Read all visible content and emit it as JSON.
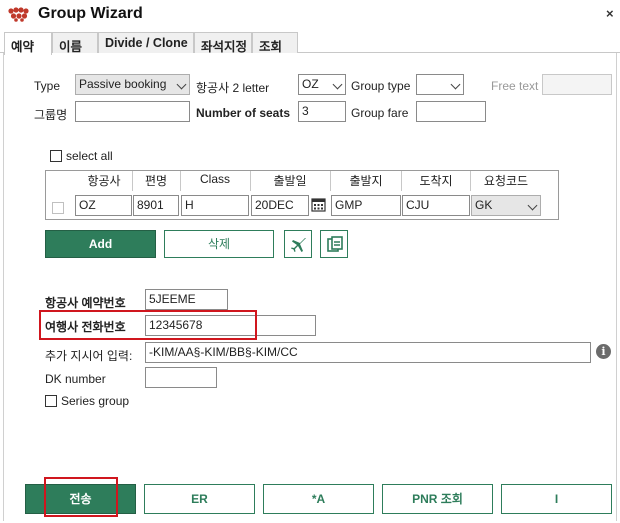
{
  "window": {
    "title": "Group Wizard",
    "close_glyph": "×"
  },
  "tabs": [
    {
      "label": "예약"
    },
    {
      "label": "이름"
    },
    {
      "label": "Divide / Clone"
    },
    {
      "label": "좌석지정"
    },
    {
      "label": "조회"
    }
  ],
  "form": {
    "type_label": "Type",
    "type_value": "Passive booking",
    "airline_label": "항공사 2 letter",
    "airline_value": "OZ",
    "group_type_label": "Group type",
    "group_type_value": "",
    "free_text_label": "Free text",
    "free_text_value": "",
    "group_name_label": "그룹명",
    "group_name_value": "",
    "seats_label": "Number of seats",
    "seats_value": "3",
    "group_fare_label": "Group fare",
    "group_fare_value": ""
  },
  "segments": {
    "select_all_label": "select all",
    "headers": [
      "항공사",
      "편명",
      "Class",
      "출발일",
      "출발지",
      "도착지",
      "요청코드"
    ],
    "rows": [
      {
        "airline": "OZ",
        "flight": "8901",
        "class": "H",
        "date": "20DEC",
        "origin": "GMP",
        "dest": "CJU",
        "code": "GK"
      }
    ],
    "add_label": "Add",
    "delete_label": "삭제"
  },
  "details": {
    "pnr_label": "항공사 예약번호",
    "pnr_value": "5JEEME",
    "phone_label": "여행사 전화번호",
    "phone_value": "12345678",
    "extra_label": "추가 지시어 입력:",
    "extra_value": "-KIM/AA§-KIM/BB§-KIM/CC",
    "dk_label": "DK number",
    "dk_value": "",
    "series_label": "Series group",
    "info_glyph": "i"
  },
  "footer": {
    "send": "전송",
    "er": "ER",
    "star_a": "*A",
    "pnr": "PNR 조회",
    "i": "I"
  },
  "colors": {
    "accent": "#2e7d5b",
    "highlight": "#d0161e"
  }
}
